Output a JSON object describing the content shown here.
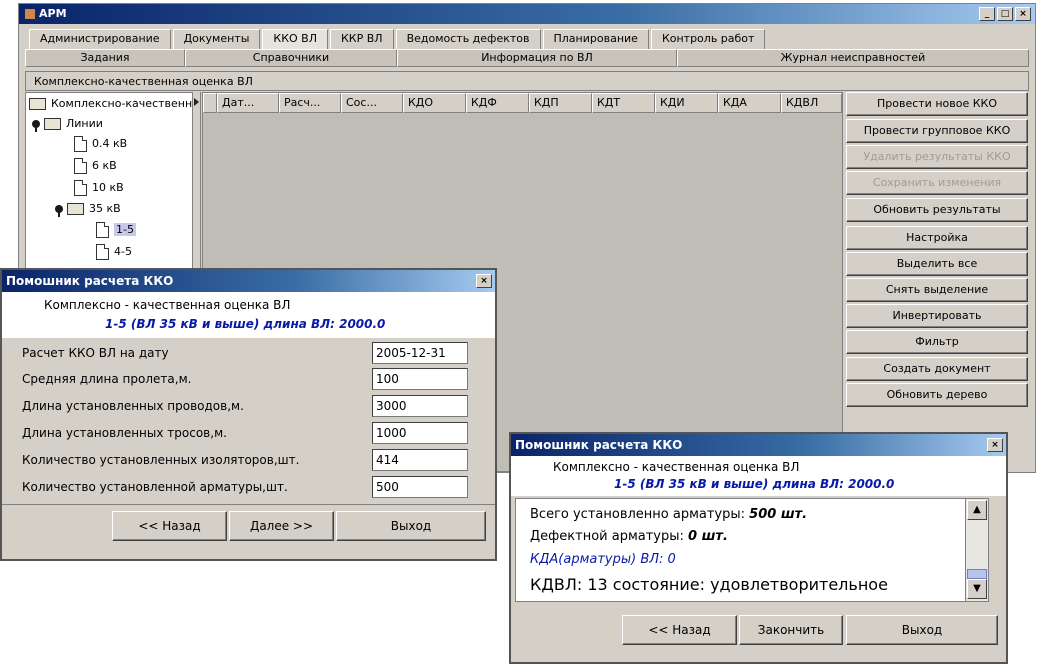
{
  "app": {
    "title": "АРМ"
  },
  "tabs_row1": [
    "Администрирование",
    "Документы",
    "ККО ВЛ",
    "ККР ВЛ",
    "Ведомость дефектов",
    "Планирование",
    "Контроль работ"
  ],
  "tabs_row2": [
    "Задания",
    "Справочники",
    "Информация по ВЛ",
    "Журнал неисправностей"
  ],
  "panel_title": "Комплексно-качественная оценка ВЛ",
  "tree": {
    "root": "Комплексно-качественна",
    "lines": "Линии",
    "kv04": "0.4 кВ",
    "kv6": "6 кВ",
    "kv10": "10 кВ",
    "kv35": "35 кВ",
    "item1": "1-5",
    "item2": "4-5"
  },
  "table": {
    "columns": [
      "Дат...",
      "Расч...",
      "Сос...",
      "КДО",
      "КДФ",
      "КДП",
      "КДТ",
      "КДИ",
      "КДА",
      "КДВЛ"
    ]
  },
  "actions": [
    {
      "label": "Провести новое ККО",
      "enabled": true
    },
    {
      "label": "Провести групповое ККО",
      "enabled": true
    },
    {
      "label": "Удалить результаты ККО",
      "enabled": false
    },
    {
      "label": "Сохранить изменения",
      "enabled": false
    },
    {
      "label": "Обновить результаты",
      "enabled": true
    },
    {
      "label": "Настройка",
      "enabled": true
    },
    {
      "label": "Выделить все",
      "enabled": true
    },
    {
      "label": "Снять выделение",
      "enabled": true
    },
    {
      "label": "Инвертировать",
      "enabled": true
    },
    {
      "label": "Фильтр",
      "enabled": true
    },
    {
      "label": "Создать документ",
      "enabled": true
    },
    {
      "label": "Обновить дерево",
      "enabled": true
    }
  ],
  "dialog1": {
    "title": "Помошник расчета ККО",
    "heading": "Комплексно - качественная оценка ВЛ",
    "subheading": "1-5 (ВЛ 35 кВ и выше) длина ВЛ: 2000.0",
    "fields": [
      {
        "label": "Расчет ККО ВЛ на дату",
        "value": "2005-12-31"
      },
      {
        "label": "Средняя длина пролета,м.",
        "value": "100"
      },
      {
        "label": "Длина установленных проводов,м.",
        "value": "3000"
      },
      {
        "label": "Длина установленных тросов,м.",
        "value": "1000"
      },
      {
        "label": "Количество установленных изоляторов,шт.",
        "value": "414"
      },
      {
        "label": "Количество установленной арматуры,шт.",
        "value": "500"
      }
    ],
    "back": "<< Назад",
    "next": "Далее >>",
    "exit": "Выход"
  },
  "dialog2": {
    "title": "Помошник расчета ККО",
    "heading": "Комплексно - качественная оценка ВЛ",
    "subheading": "1-5 (ВЛ 35 кВ и выше) длина ВЛ: 2000.0",
    "line1_label": "Всего установленно арматуры:",
    "line1_value": "500 шт.",
    "line2_label": "Дефектной арматуры:",
    "line2_value": "0 шт.",
    "line3": "КДА(арматуры) ВЛ: 0",
    "line4": "КДВЛ: 13 состояние: удовлетворительное",
    "back": "<< Назад",
    "finish": "Закончить",
    "exit": "Выход"
  },
  "colors": {
    "title_bar": "#0a246a",
    "blue_text": "#0a1aa8",
    "face": "#d4d0c8",
    "grid_bg": "#c0bdb6"
  }
}
